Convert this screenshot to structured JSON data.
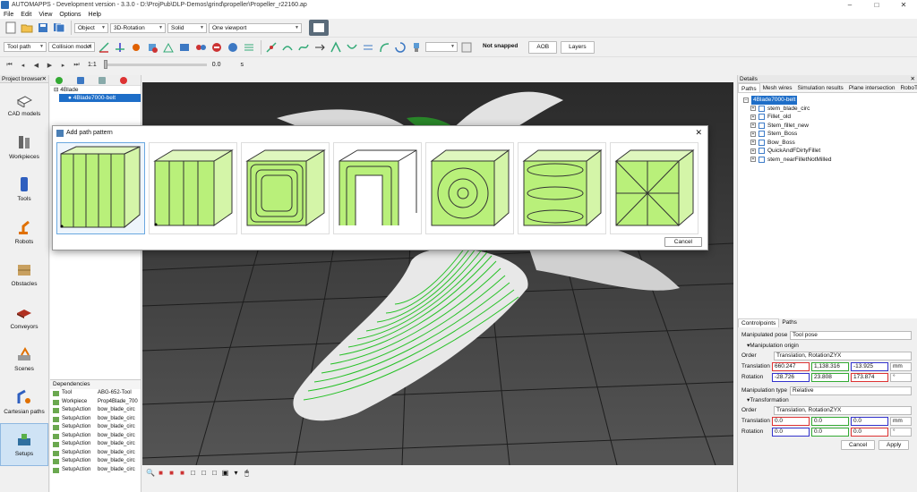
{
  "window": {
    "title": "AUTOMAPPS - Development version - 3.3.0 - D:\\ProjPub\\DLP-Demos\\grind\\propeller\\Propeller_r22160.ap"
  },
  "menu": [
    "File",
    "Edit",
    "View",
    "Options",
    "Help"
  ],
  "toolbar1": {
    "mode": "Object",
    "rotation": "3D-Rotation",
    "shading": "Solid",
    "viewport": "One viewport"
  },
  "toolbar2": {
    "model": "Tool path",
    "collision": "Collision model",
    "snap": "Not snapped",
    "aob": "AOB",
    "layers": "Layers"
  },
  "toolbar3": {
    "speed": "1:1",
    "time": "0.0",
    "unit": "s"
  },
  "project_browser": {
    "title": "Project browser",
    "items": [
      {
        "label": "CAD models",
        "icon": "cad-model-icon"
      },
      {
        "label": "Workpieces",
        "icon": "workpiece-icon"
      },
      {
        "label": "Tools",
        "icon": "tool-icon"
      },
      {
        "label": "Robots",
        "icon": "robot-icon"
      },
      {
        "label": "Obstacles",
        "icon": "obstacle-icon"
      },
      {
        "label": "Conveyors",
        "icon": "conveyor-icon"
      },
      {
        "label": "Scenes",
        "icon": "scene-icon"
      },
      {
        "label": "Cartesian paths",
        "icon": "cartesian-path-icon"
      },
      {
        "label": "Setups",
        "icon": "setup-icon"
      }
    ]
  },
  "tree": {
    "root": "4Blade",
    "selected": "4Blade7000-belt"
  },
  "dependencies": {
    "title": "Dependencies",
    "rows": [
      [
        "Tool",
        "ABG-652-Tool"
      ],
      [
        "Workpiece",
        "Prop4Blade_700"
      ],
      [
        "SetupAction",
        "bow_blade_circ"
      ],
      [
        "SetupAction",
        "bow_blade_circ"
      ],
      [
        "SetupAction",
        "bow_blade_circ"
      ],
      [
        "SetupAction",
        "bow_blade_circ"
      ],
      [
        "SetupAction",
        "bow_blade_circ"
      ],
      [
        "SetupAction",
        "bow_blade_circ"
      ],
      [
        "SetupAction",
        "bow_blade_circ"
      ],
      [
        "SetupAction",
        "bow_blade_circ"
      ]
    ]
  },
  "dialog": {
    "title": "Add path pattern",
    "cancel": "Cancel",
    "patterns": [
      "pattern-vertical-strips-icon",
      "pattern-vertical-strips-start-icon",
      "pattern-offset-contours-icon",
      "pattern-u-contours-icon",
      "pattern-concentric-circles-icon",
      "pattern-cylinder-rings-icon",
      "pattern-radial-star-icon"
    ]
  },
  "details": {
    "title": "Details",
    "tabs": [
      "Paths",
      "Mesh wires",
      "Simulation results",
      "Plane intersection",
      "RoboTra"
    ],
    "rows": [
      {
        "label": "4Blade7000-belt",
        "selected": true
      },
      {
        "label": "stem_blade_circ"
      },
      {
        "label": "Fillet_old"
      },
      {
        "label": "Stem_fillet_new"
      },
      {
        "label": "Stem_Boss"
      },
      {
        "label": "Bow_Boss"
      },
      {
        "label": "QuickAndFDirtyFillet"
      },
      {
        "label": "stem_nearFilletNotMilled"
      }
    ]
  },
  "props": {
    "tabs": [
      "Controlpoints",
      "Paths"
    ],
    "manip_pose_label": "Manipulated pose",
    "manip_pose_value": "Tool pose",
    "manip_origin": "Manipulation origin",
    "order_label": "Order",
    "order_value": "Translation, RotationZYX",
    "translation_label": "Translation",
    "translation": [
      "660.247",
      "1,138.316",
      "-13.925"
    ],
    "translation_unit": "mm",
    "rotation_label": "Rotation",
    "rotation": [
      "-28.726",
      "23.808",
      "173.874"
    ],
    "rotation_unit": "°",
    "manip_type_label": "Manipulation type",
    "manip_type_value": "Relative",
    "transformation": "Transformation",
    "order2_value": "Translation, RotationZYX",
    "translation2": [
      "0.0",
      "0.0",
      "0.0"
    ],
    "rotation2": [
      "0.0",
      "0.0",
      "0.0"
    ],
    "cancel": "Cancel",
    "apply": "Apply"
  }
}
